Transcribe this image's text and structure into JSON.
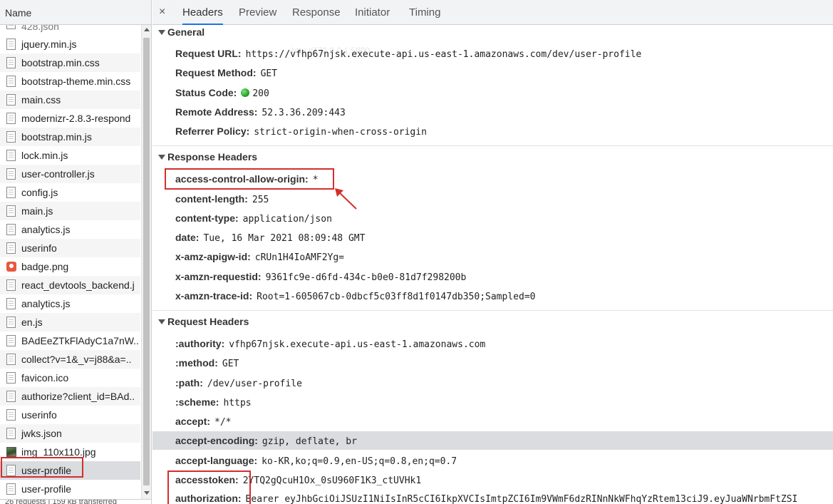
{
  "left_panel": {
    "header": "Name",
    "partial_top": "428.json",
    "files": [
      {
        "name": "jquery.min.js",
        "icon": "file-icon"
      },
      {
        "name": "bootstrap.min.css",
        "icon": "file-icon"
      },
      {
        "name": "bootstrap-theme.min.css",
        "icon": "file-icon"
      },
      {
        "name": "main.css",
        "icon": "file-icon"
      },
      {
        "name": "modernizr-2.8.3-respond",
        "icon": "file-icon"
      },
      {
        "name": "bootstrap.min.js",
        "icon": "file-icon"
      },
      {
        "name": "lock.min.js",
        "icon": "file-icon"
      },
      {
        "name": "user-controller.js",
        "icon": "file-icon"
      },
      {
        "name": "config.js",
        "icon": "file-icon"
      },
      {
        "name": "main.js",
        "icon": "file-icon"
      },
      {
        "name": "analytics.js",
        "icon": "file-icon"
      },
      {
        "name": "userinfo",
        "icon": "file-icon"
      },
      {
        "name": "badge.png",
        "icon": "image-badge-icon"
      },
      {
        "name": "react_devtools_backend.j",
        "icon": "file-icon"
      },
      {
        "name": "analytics.js",
        "icon": "file-icon"
      },
      {
        "name": "en.js",
        "icon": "file-icon"
      },
      {
        "name": "BAdEeZTkFlAdyC1a7nW..",
        "icon": "file-icon"
      },
      {
        "name": "collect?v=1&_v=j88&a=..",
        "icon": "file-icon"
      },
      {
        "name": "favicon.ico",
        "icon": "file-icon"
      },
      {
        "name": "authorize?client_id=BAd..",
        "icon": "file-icon"
      },
      {
        "name": "userinfo",
        "icon": "file-icon"
      },
      {
        "name": "jwks.json",
        "icon": "file-icon"
      },
      {
        "name": "img_110x110.jpg",
        "icon": "image-photo-icon"
      },
      {
        "name": "user-profile",
        "icon": "file-icon"
      },
      {
        "name": "user-profile",
        "icon": "file-icon"
      }
    ],
    "status_bar": "26 requests | 159 kB transferred"
  },
  "tabs": {
    "close": "×",
    "items": [
      "Headers",
      "Preview",
      "Response",
      "Initiator",
      "Timing"
    ],
    "active": "Headers"
  },
  "faint_overlay": "http://172.0.0.1:5000",
  "general": {
    "title": "General",
    "rows": [
      {
        "key": "Request URL:",
        "value": "https://vfhp67njsk.execute-api.us-east-1.amazonaws.com/dev/user-profile"
      },
      {
        "key": "Request Method:",
        "value": "GET"
      },
      {
        "key": "Status Code:",
        "value": "200"
      },
      {
        "key": "Remote Address:",
        "value": "52.3.36.209:443"
      },
      {
        "key": "Referrer Policy:",
        "value": "strict-origin-when-cross-origin"
      }
    ]
  },
  "response_headers": {
    "title": "Response Headers",
    "rows": [
      {
        "key": "access-control-allow-origin:",
        "value": "*"
      },
      {
        "key": "content-length:",
        "value": "255"
      },
      {
        "key": "content-type:",
        "value": "application/json"
      },
      {
        "key": "date:",
        "value": "Tue, 16 Mar 2021 08:09:48 GMT"
      },
      {
        "key": "x-amz-apigw-id:",
        "value": "cRUn1H4IoAMF2Yg="
      },
      {
        "key": "x-amzn-requestid:",
        "value": "9361fc9e-d6fd-434c-b0e0-81d7f298200b"
      },
      {
        "key": "x-amzn-trace-id:",
        "value": "Root=1-605067cb-0dbcf5c03ff8d1f0147db350;Sampled=0"
      }
    ]
  },
  "request_headers": {
    "title": "Request Headers",
    "rows": [
      {
        "key": ":authority:",
        "value": "vfhp67njsk.execute-api.us-east-1.amazonaws.com"
      },
      {
        "key": ":method:",
        "value": "GET"
      },
      {
        "key": ":path:",
        "value": "/dev/user-profile"
      },
      {
        "key": ":scheme:",
        "value": "https"
      },
      {
        "key": "accept:",
        "value": "*/*"
      },
      {
        "key": "accept-encoding:",
        "value": "gzip, deflate, br"
      },
      {
        "key": "accept-language:",
        "value": "ko-KR,ko;q=0.9,en-US;q=0.8,en;q=0.7"
      },
      {
        "key": "accesstoken:",
        "value": "2YTQ2gQcuH1Ox_0sU960F1K3_ctUVHk1"
      },
      {
        "key": "authorization:",
        "value": "Bearer eyJhbGciOiJSUzI1NiIsInR5cCI6IkpXVCIsImtpZCI6Im9VWmF6dzRINnNkWFhqYzRtem13ciJ9.eyJuaWNrbmFtZSI"
      }
    ]
  },
  "colors": {
    "annotation_red": "#d32f2f",
    "status_ok_green": "#1a9a1a",
    "active_tab_blue": "#1a73e8"
  }
}
